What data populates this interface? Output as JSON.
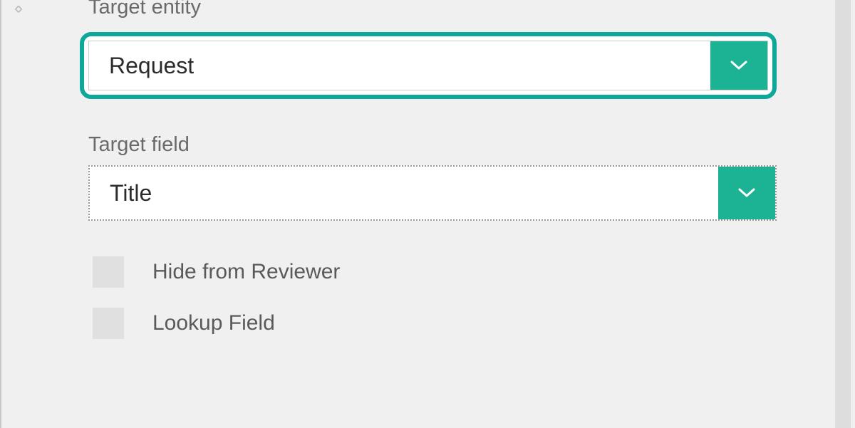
{
  "colors": {
    "accent": "#1bb394",
    "highlight_border": "#0fa79a"
  },
  "fields": {
    "target_entity": {
      "label": "Target entity",
      "value": "Request"
    },
    "target_field": {
      "label": "Target field",
      "value": "Title"
    }
  },
  "checkboxes": {
    "hide_from_reviewer": {
      "label": "Hide from Reviewer",
      "checked": false
    },
    "lookup_field": {
      "label": "Lookup Field",
      "checked": false
    }
  }
}
